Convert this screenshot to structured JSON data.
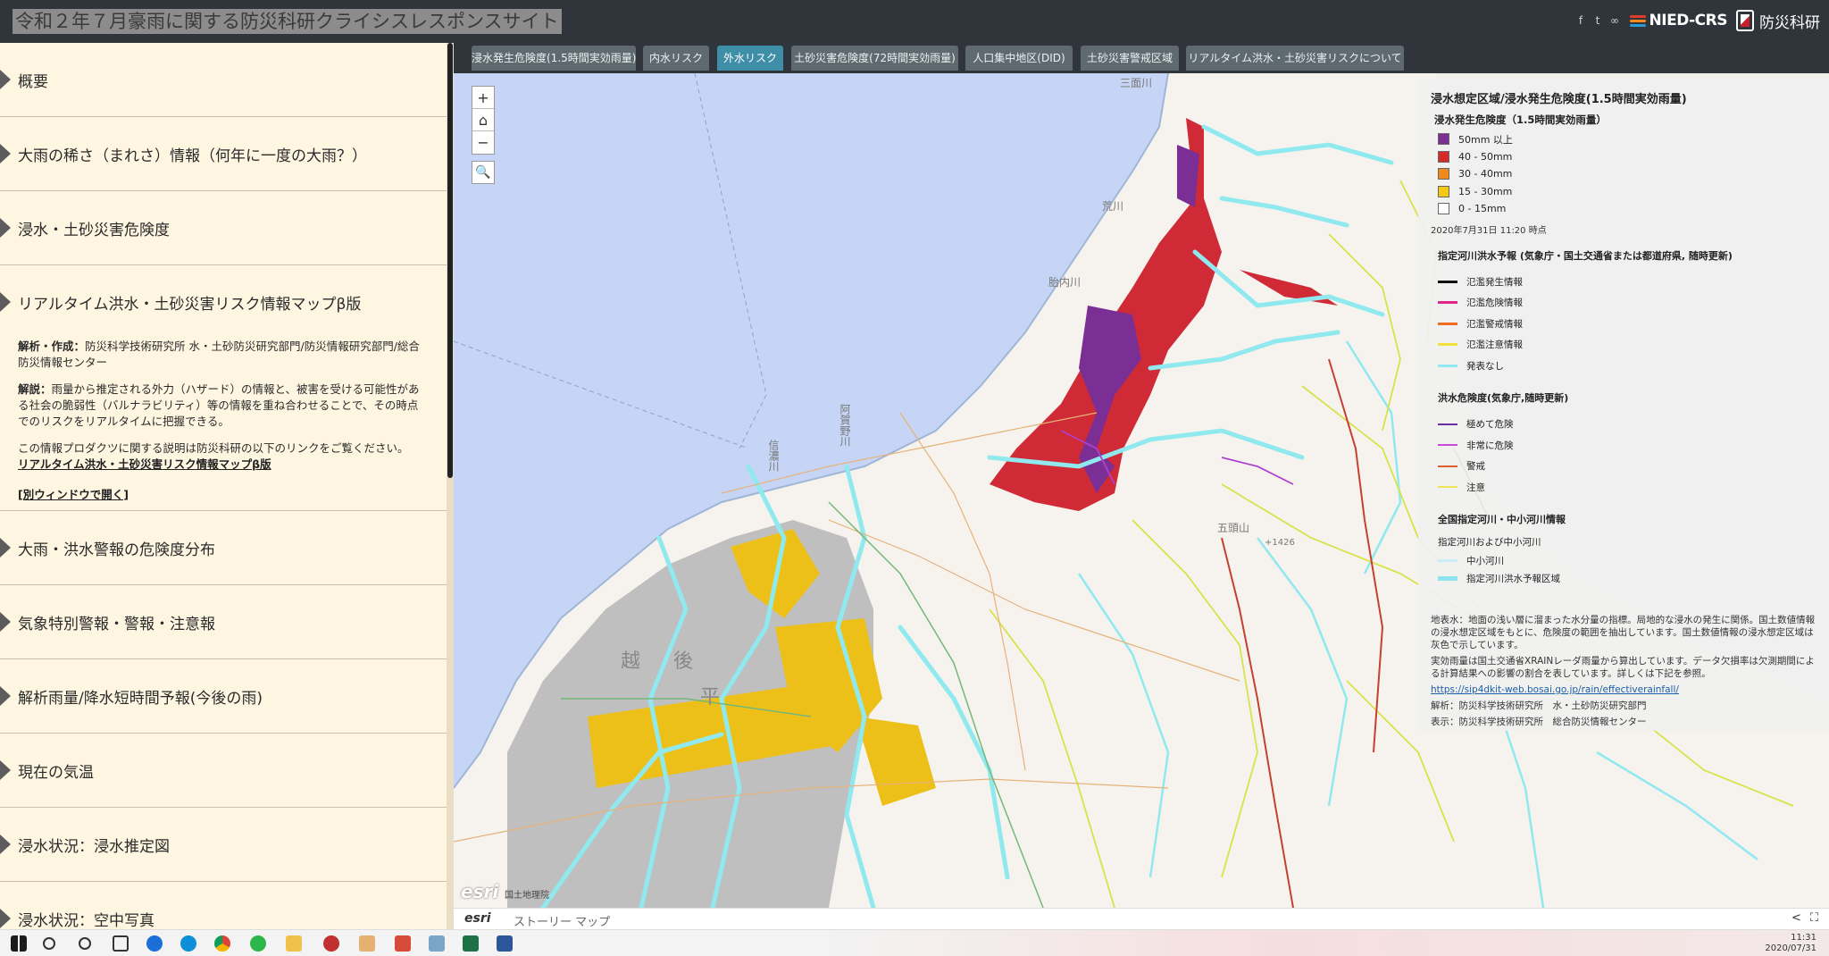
{
  "header": {
    "site_title": "令和２年７月豪雨に関する防災科研クライシスレスポンスサイト",
    "logo_nied": "NIED-CRS",
    "logo_bosai": "防災科研"
  },
  "sidebar": {
    "items": [
      {
        "label": "概要"
      },
      {
        "label": "大雨の稀さ（まれさ）情報（何年に一度の大雨？）"
      },
      {
        "label": "浸水・土砂災害危険度"
      },
      {
        "label": "リアルタイム洪水・土砂災害リスク情報マップβ版"
      },
      {
        "label": "大雨・洪水警報の危険度分布"
      },
      {
        "label": "気象特別警報・警報・注意報"
      },
      {
        "label": "解析雨量/降水短時間予報(今後の雨)"
      },
      {
        "label": "現在の気温"
      },
      {
        "label": "浸水状況：浸水推定図"
      },
      {
        "label": "浸水状況：空中写真"
      }
    ],
    "expanded": {
      "author_label": "解析・作成：",
      "author_text": "防災科学技術研究所 水・土砂防災研究部門/防災情報研究部門/総合防災情報センター",
      "desc_label": "解説：",
      "desc_text": "雨量から推定される外力（ハザード）の情報と、被害を受ける可能性がある社会の脆弱性（バルナラビリティ）等の情報を重ね合わせることで、その時点でのリスクをリアルタイムに把握できる。",
      "link_intro": "この情報プロダクツに関する説明は防災科研の以下のリンクをご覧ください。",
      "link_text": "リアルタイム洪水・土砂災害リスク情報マップβ版",
      "new_window": "[別ウィンドウで開く]"
    }
  },
  "tabs": [
    {
      "label": "浸水発生危険度(1.5時間実効雨量)",
      "active": false
    },
    {
      "label": "内水リスク",
      "active": false
    },
    {
      "label": "外水リスク",
      "active": true
    },
    {
      "label": "土砂災害危険度(72時間実効雨量)",
      "active": false
    },
    {
      "label": "人口集中地区(DID)",
      "active": false
    },
    {
      "label": "土砂災害警戒区域",
      "active": false
    },
    {
      "label": "リアルタイム洪水・土砂災害リスクについて",
      "active": false
    }
  ],
  "map": {
    "zoom_in": "+",
    "home": "⌂",
    "zoom_out": "−",
    "search": "🔍",
    "labels": {
      "echigo": "越",
      "go": "後",
      "hei": "平",
      "sanmen": "三面川",
      "ara": "荒川",
      "tai": "胎内川",
      "aga": "阿賀野川",
      "shinano": "信濃川",
      "gomon": "五頭山",
      "hyo": "+1426"
    },
    "esri": "esri",
    "credit": "国土地理院"
  },
  "legend": {
    "title": "浸水想定区域/浸水発生危険度(1.5時間実効雨量)",
    "section1_title": "浸水発生危険度（1.5時間実効雨量）",
    "section1": [
      {
        "label": "50mm 以上",
        "color": "#7b2f95"
      },
      {
        "label": "40 - 50mm",
        "color": "#d42a2a"
      },
      {
        "label": "30 - 40mm",
        "color": "#f08a1c"
      },
      {
        "label": "15 - 30mm",
        "color": "#f6c914"
      },
      {
        "label": "0 - 15mm",
        "color": "#ffffff"
      }
    ],
    "timestamp": "2020年7月31日 11:20 時点",
    "section2_title": "指定河川洪水予報 (気象庁・国土交通省または都道府県, 随時更新)",
    "section2": [
      {
        "label": "氾濫発生情報",
        "color": "#111111"
      },
      {
        "label": "氾濫危険情報",
        "color": "#e0268a"
      },
      {
        "label": "氾濫警戒情報",
        "color": "#ef6c1f"
      },
      {
        "label": "氾濫注意情報",
        "color": "#f2e13a"
      },
      {
        "label": "発表なし",
        "color": "#8fe9ef"
      }
    ],
    "section3_title": "洪水危険度(気象庁,随時更新)",
    "section3": [
      {
        "label": "極めて危険",
        "color": "#6b2ea1"
      },
      {
        "label": "非常に危険",
        "color": "#c84ad8"
      },
      {
        "label": "警戒",
        "color": "#e0602d"
      },
      {
        "label": "注意",
        "color": "#ece45a"
      }
    ],
    "section4_title": "全国指定河川・中小河川情報",
    "section4_sub": "指定河川および中小河川",
    "section4": [
      {
        "label": "中小河川",
        "color": "#c8eef3"
      },
      {
        "label": "指定河川洪水予報区域",
        "color": "#8fe3ec"
      }
    ],
    "desc1": "地表水：地面の浅い層に溜まった水分量の指標。局地的な浸水の発生に関係。国土数値情報の浸水想定区域をもとに、危険度の範囲を抽出しています。国土数値情報の浸水想定区域は灰色で示しています。",
    "desc2": "実効雨量は国土交通省XRAINレーダ雨量から算出しています。データ欠損率は欠測期間による計算結果への影響の割合を表しています。詳しくは下記を参照。",
    "link": "https://sip4dkit-web.bosai.go.jp/rain/effectiverainfall/",
    "credit1": "解析：防災科学技術研究所　水・土砂防災研究部門",
    "credit2": "表示：防災科学技術研究所　総合防災情報センター"
  },
  "footer": {
    "brand": "esri",
    "name": "ストーリー マップ"
  },
  "taskbar": {
    "time": "11:31",
    "date": "2020/07/31"
  }
}
